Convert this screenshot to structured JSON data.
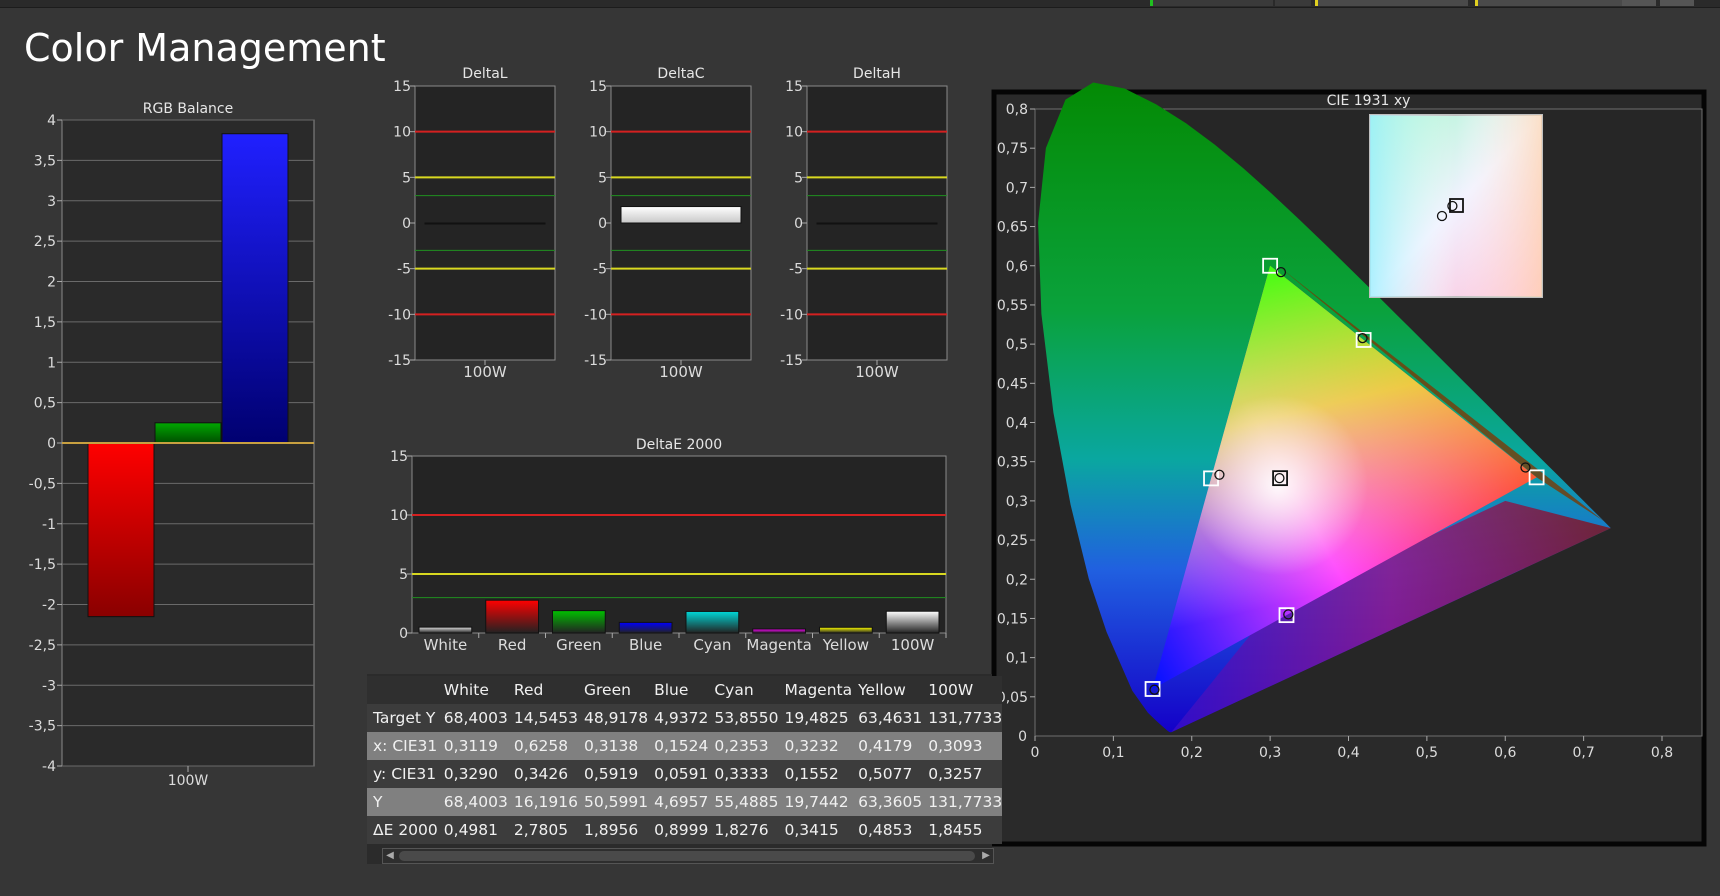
{
  "page": {
    "title": "Color Management"
  },
  "colors": {
    "bg": "#363636",
    "panel": "#282828",
    "red_line": "#d42020",
    "yellow_line": "#d8d820",
    "green_line": "#1f8f1f"
  },
  "chart_data": [
    {
      "id": "rgb-balance",
      "type": "bar",
      "title": "RGB Balance",
      "categories": [
        "100W"
      ],
      "series": [
        {
          "values": [
            -2.15
          ],
          "color": "#ff0000"
        },
        {
          "values": [
            0.25
          ],
          "color": "#00a000"
        },
        {
          "values": [
            3.83
          ],
          "color": "#1a1aff"
        }
      ],
      "ylim": [
        -4,
        4
      ],
      "yticks": [
        "4",
        "3,5",
        "3",
        "2,5",
        "2",
        "1,5",
        "1",
        "0,5",
        "0",
        "-0,5",
        "-1",
        "-1,5",
        "-2",
        "-2,5",
        "-3",
        "-3,5",
        "-4"
      ],
      "grid": true
    },
    {
      "id": "delta-l",
      "type": "bar",
      "title": "DeltaL",
      "categories": [
        "100W"
      ],
      "values": [
        0.0
      ],
      "ylim": [
        -15,
        15
      ],
      "yticks": [
        "15",
        "10",
        "5",
        "0",
        "-5",
        "-10",
        "-15"
      ],
      "reference_lines": [
        10,
        5,
        3,
        -3,
        -5,
        -10
      ]
    },
    {
      "id": "delta-c",
      "type": "bar",
      "title": "DeltaC",
      "categories": [
        "100W"
      ],
      "values": [
        1.8
      ],
      "ylim": [
        -15,
        15
      ],
      "yticks": [
        "15",
        "10",
        "5",
        "0",
        "-5",
        "-10",
        "-15"
      ],
      "reference_lines": [
        10,
        5,
        3,
        -3,
        -5,
        -10
      ]
    },
    {
      "id": "delta-h",
      "type": "bar",
      "title": "DeltaH",
      "categories": [
        "100W"
      ],
      "values": [
        0.0
      ],
      "ylim": [
        -15,
        15
      ],
      "yticks": [
        "15",
        "10",
        "5",
        "0",
        "-5",
        "-10",
        "-15"
      ],
      "reference_lines": [
        10,
        5,
        3,
        -3,
        -5,
        -10
      ]
    },
    {
      "id": "delta-e-2000",
      "type": "bar",
      "title": "DeltaE 2000",
      "categories": [
        "White",
        "Red",
        "Green",
        "Blue",
        "Cyan",
        "Magenta",
        "Yellow",
        "100W"
      ],
      "values": [
        0.4981,
        2.7805,
        1.8956,
        0.8999,
        1.8276,
        0.3415,
        0.4853,
        1.8455
      ],
      "colors": [
        "#e0e0e0",
        "#ff0000",
        "#00c000",
        "#0000ff",
        "#00d8d8",
        "#ff00ff",
        "#ffff00",
        "#ffffff"
      ],
      "ylim": [
        0,
        15
      ],
      "yticks": [
        "15",
        "10",
        "5",
        "0"
      ],
      "reference_lines": [
        10,
        5,
        3
      ]
    },
    {
      "id": "cie-1931",
      "type": "scatter",
      "title": "CIE 1931 xy",
      "xlim": [
        0,
        0.8
      ],
      "ylim": [
        0,
        0.8
      ],
      "xticks": [
        "0",
        "0,1",
        "0,2",
        "0,3",
        "0,4",
        "0,5",
        "0,6",
        "0,7",
        "0,8"
      ],
      "yticks": [
        "0,05",
        "0,1",
        "0,15",
        "0,2",
        "0,25",
        "0,3",
        "0,35",
        "0,4",
        "0,45",
        "0,5",
        "0,55",
        "0,6",
        "0,65",
        "0,7",
        "0,75",
        "0,8"
      ],
      "gamut_triangle": [
        [
          0.64,
          0.33
        ],
        [
          0.3,
          0.6
        ],
        [
          0.15,
          0.06
        ]
      ],
      "targets": [
        {
          "x": 0.64,
          "y": 0.33
        },
        {
          "x": 0.3,
          "y": 0.6
        },
        {
          "x": 0.15,
          "y": 0.06
        },
        {
          "x": 0.3127,
          "y": 0.329
        },
        {
          "x": 0.2246,
          "y": 0.3287
        },
        {
          "x": 0.3209,
          "y": 0.1542
        },
        {
          "x": 0.4193,
          "y": 0.5053
        }
      ],
      "measured": [
        {
          "x": 0.6258,
          "y": 0.3426
        },
        {
          "x": 0.3138,
          "y": 0.5919
        },
        {
          "x": 0.1524,
          "y": 0.0591
        },
        {
          "x": 0.3119,
          "y": 0.329
        },
        {
          "x": 0.2353,
          "y": 0.3333
        },
        {
          "x": 0.3232,
          "y": 0.1552
        },
        {
          "x": 0.4179,
          "y": 0.5077
        }
      ]
    }
  ],
  "table": {
    "columns": [
      "White",
      "Red",
      "Green",
      "Blue",
      "Cyan",
      "Magenta",
      "Yellow",
      "100W"
    ],
    "rows": [
      {
        "label": "Target Y",
        "values": [
          "68,4003",
          "14,5453",
          "48,9178",
          "4,9372",
          "53,8550",
          "19,4825",
          "63,4631",
          "131,7733"
        ]
      },
      {
        "label": "x: CIE31",
        "values": [
          "0,3119",
          "0,6258",
          "0,3138",
          "0,1524",
          "0,2353",
          "0,3232",
          "0,4179",
          "0,3093"
        ]
      },
      {
        "label": "y: CIE31",
        "values": [
          "0,3290",
          "0,3426",
          "0,5919",
          "0,0591",
          "0,3333",
          "0,1552",
          "0,5077",
          "0,3257"
        ]
      },
      {
        "label": "Y",
        "values": [
          "68,4003",
          "16,1916",
          "50,5991",
          "4,6957",
          "55,4885",
          "19,7442",
          "63,3605",
          "131,7733"
        ]
      },
      {
        "label": "ΔE 2000",
        "values": [
          "0,4981",
          "2,7805",
          "1,8956",
          "0,8999",
          "1,8276",
          "0,3415",
          "0,4853",
          "1,8455"
        ]
      }
    ]
  }
}
